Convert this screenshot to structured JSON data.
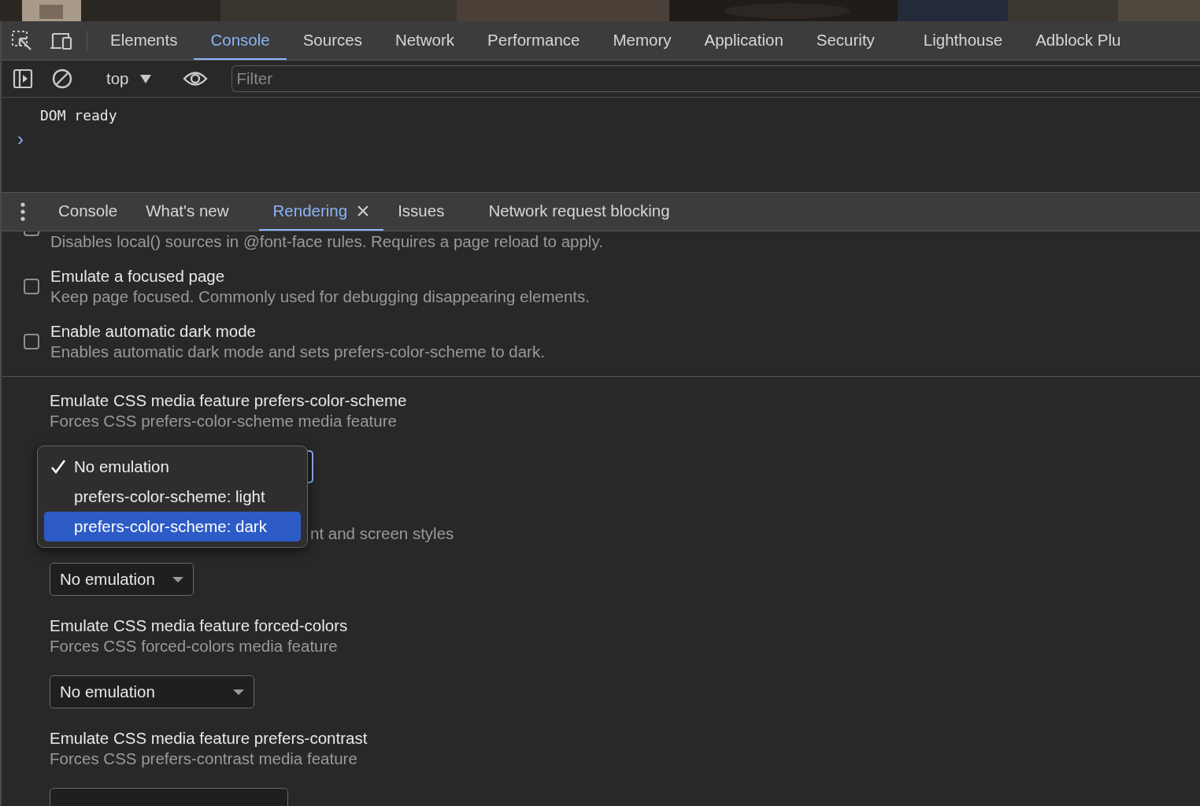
{
  "main_tabs": [
    {
      "label": "Elements",
      "selected": false
    },
    {
      "label": "Console",
      "selected": true
    },
    {
      "label": "Sources",
      "selected": false
    },
    {
      "label": "Network",
      "selected": false
    },
    {
      "label": "Performance",
      "selected": false
    },
    {
      "label": "Memory",
      "selected": false
    },
    {
      "label": "Application",
      "selected": false
    },
    {
      "label": "Security",
      "selected": false
    },
    {
      "label": "Lighthouse",
      "selected": false
    },
    {
      "label": "Adblock Plu",
      "selected": false
    }
  ],
  "console_toolbar": {
    "context": "top",
    "filter": {
      "placeholder": "Filter"
    }
  },
  "console": {
    "messages": [
      "DOM ready"
    ],
    "prompt": "›"
  },
  "drawer_tabs": [
    {
      "label": "Console",
      "selected": false,
      "closable": false
    },
    {
      "label": "What's new",
      "selected": false,
      "closable": false
    },
    {
      "label": "Rendering",
      "selected": true,
      "closable": true
    },
    {
      "label": "Issues",
      "selected": false,
      "closable": false
    },
    {
      "label": "Network request blocking",
      "selected": false,
      "closable": false
    }
  ],
  "rendering": {
    "options": [
      {
        "description": "Disables local() sources in @font-face rules. Requires a page reload to apply.",
        "checked": false
      },
      {
        "title": "Emulate a focused page",
        "description": "Keep page focused. Commonly used for debugging disappearing elements.",
        "checked": false
      },
      {
        "title": "Enable automatic dark mode",
        "description": "Enables automatic dark mode and sets prefers-color-scheme to dark.",
        "checked": false
      }
    ],
    "media_features": [
      {
        "title": "Emulate CSS media feature prefers-color-scheme",
        "description": "Forces CSS prefers-color-scheme media feature",
        "select": {
          "focused": true
        }
      },
      {
        "description": "nt and screen styles",
        "select": {
          "value": "No emulation",
          "focused": false
        }
      },
      {
        "title": "Emulate CSS media feature forced-colors",
        "description": "Forces CSS forced-colors media feature",
        "select": {
          "value": "No emulation",
          "focused": false
        }
      },
      {
        "title": "Emulate CSS media feature prefers-contrast",
        "description": "Forces CSS prefers-contrast media feature",
        "select": {
          "focused": false
        }
      }
    ]
  },
  "dropdown_menu": {
    "options": [
      {
        "label": "No emulation",
        "checked": true,
        "selected": false
      },
      {
        "label": "prefers-color-scheme: light",
        "checked": false,
        "selected": false
      },
      {
        "label": "prefers-color-scheme: dark",
        "checked": false,
        "selected": true
      }
    ]
  }
}
